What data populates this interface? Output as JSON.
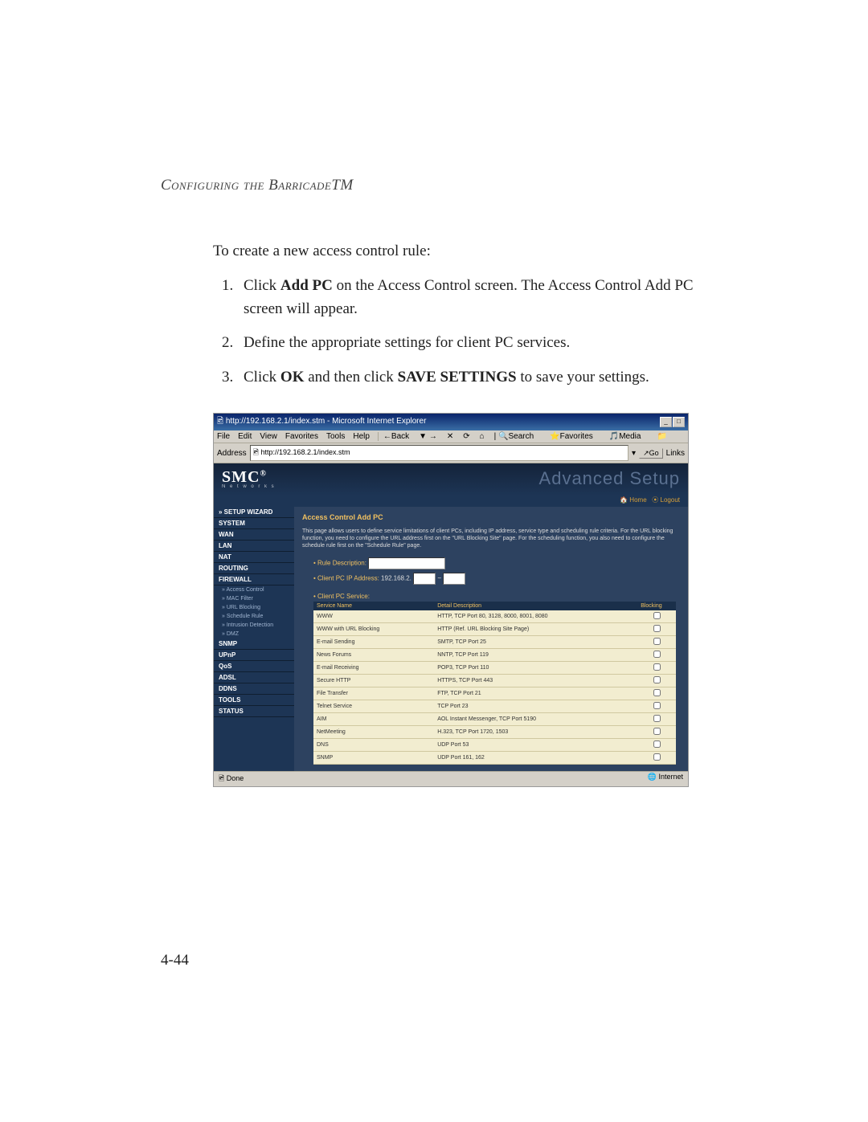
{
  "chapter_header": "Configuring the BarricadeTM",
  "intro": "To create a new access control rule:",
  "steps": [
    {
      "pre": "Click ",
      "bold": "Add PC",
      "post": " on the Access Control screen. The Access Control Add PC screen will appear."
    },
    {
      "pre": "Define the appropriate settings for client PC services.",
      "bold": "",
      "post": ""
    },
    {
      "pre": "Click ",
      "bold": "OK",
      "post": " and then click ",
      "bold2": "SAVE SETTINGS",
      "post2": " to save your settings."
    }
  ],
  "ie": {
    "title": "http://192.168.2.1/index.stm - Microsoft Internet Explorer",
    "menu": [
      "File",
      "Edit",
      "View",
      "Favorites",
      "Tools",
      "Help"
    ],
    "toolbar": {
      "back": "←Back",
      "search": "Search",
      "favorites": "Favorites",
      "media": "Media"
    },
    "address_label": "Address",
    "address_url": "http://192.168.2.1/index.stm",
    "go": "Go",
    "links": "Links",
    "status_left": "Done",
    "status_right": "Internet"
  },
  "router": {
    "logo": "SMC",
    "logo_sub": "N e t w o r k s",
    "adv": "Advanced Setup",
    "home": "Home",
    "logout": "Logout",
    "sidebar": [
      {
        "label": "» SETUP WIZARD",
        "type": "item"
      },
      {
        "label": "SYSTEM",
        "type": "item"
      },
      {
        "label": "WAN",
        "type": "item"
      },
      {
        "label": "LAN",
        "type": "item"
      },
      {
        "label": "NAT",
        "type": "item"
      },
      {
        "label": "ROUTING",
        "type": "item"
      },
      {
        "label": "FIREWALL",
        "type": "item"
      },
      {
        "label": "» Access Control",
        "type": "sub"
      },
      {
        "label": "» MAC Filter",
        "type": "sub"
      },
      {
        "label": "» URL Blocking",
        "type": "sub"
      },
      {
        "label": "» Schedule Rule",
        "type": "sub"
      },
      {
        "label": "» Intrusion Detection",
        "type": "sub"
      },
      {
        "label": "» DMZ",
        "type": "sub"
      },
      {
        "label": "SNMP",
        "type": "item"
      },
      {
        "label": "UPnP",
        "type": "item"
      },
      {
        "label": "QoS",
        "type": "item"
      },
      {
        "label": "ADSL",
        "type": "item"
      },
      {
        "label": "DDNS",
        "type": "item"
      },
      {
        "label": "TOOLS",
        "type": "item"
      },
      {
        "label": "STATUS",
        "type": "item"
      }
    ],
    "content_title": "Access Control Add PC",
    "content_desc": "This page allows users to define service limitations of client PCs, including IP address, service type and scheduling rule criteria. For the URL blocking function, you need to configure the URL address first on the \"URL Blocking Site\" page. For the scheduling function, you also need to configure the schedule rule first on the \"Schedule Rule\" page.",
    "rule_label": "• Rule Description:",
    "ip_label": "• Client PC IP Address:",
    "ip_prefix": "192.168.2.",
    "ip_sep": "~",
    "svc_label": "• Client PC Service:",
    "table_headers": [
      "Service Name",
      "Detail Description",
      "Blocking"
    ],
    "services": [
      {
        "name": "WWW",
        "desc": "HTTP, TCP Port 80, 3128, 8000, 8001, 8080"
      },
      {
        "name": "WWW with URL Blocking",
        "desc": "HTTP (Ref. URL Blocking Site Page)"
      },
      {
        "name": "E-mail Sending",
        "desc": "SMTP, TCP Port 25"
      },
      {
        "name": "News Forums",
        "desc": "NNTP, TCP Port 119"
      },
      {
        "name": "E-mail Receiving",
        "desc": "POP3, TCP Port 110"
      },
      {
        "name": "Secure HTTP",
        "desc": "HTTPS, TCP Port 443"
      },
      {
        "name": "File Transfer",
        "desc": "FTP, TCP Port 21"
      },
      {
        "name": "Telnet Service",
        "desc": "TCP Port 23"
      },
      {
        "name": "AIM",
        "desc": "AOL Instant Messenger, TCP Port 5190"
      },
      {
        "name": "NetMeeting",
        "desc": "H.323, TCP Port 1720, 1503"
      },
      {
        "name": "DNS",
        "desc": "UDP Port 53"
      },
      {
        "name": "SNMP",
        "desc": "UDP Port 161, 162"
      }
    ]
  },
  "page_num": "4-44"
}
